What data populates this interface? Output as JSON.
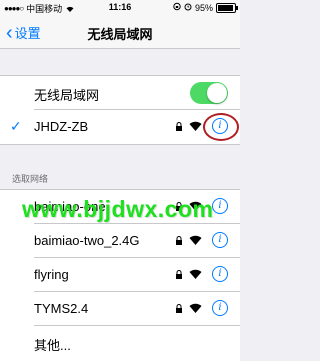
{
  "status_bar": {
    "carrier": "中国移动",
    "time": "11:16",
    "battery": "95%",
    "battery_level": 0.95
  },
  "nav": {
    "back_label": "设置",
    "title": "无线局域网"
  },
  "wifi_toggle": {
    "label": "无线局域网",
    "on": true
  },
  "connected_network": {
    "name": "JHDZ-ZB",
    "locked": true
  },
  "section_header": "选取网络",
  "networks": [
    {
      "name": "baimiao-one",
      "locked": true
    },
    {
      "name": "baimiao-two_2.4G",
      "locked": true
    },
    {
      "name": "flyring",
      "locked": true
    },
    {
      "name": "TYMS2.4",
      "locked": true
    },
    {
      "name": "其他...",
      "locked": false
    }
  ],
  "watermark": "www.bjjdwx.com",
  "colors": {
    "accent": "#007aff",
    "toggle_on": "#4cd964",
    "highlight_ring": "#b01e23",
    "watermark": "#1ee01e"
  }
}
